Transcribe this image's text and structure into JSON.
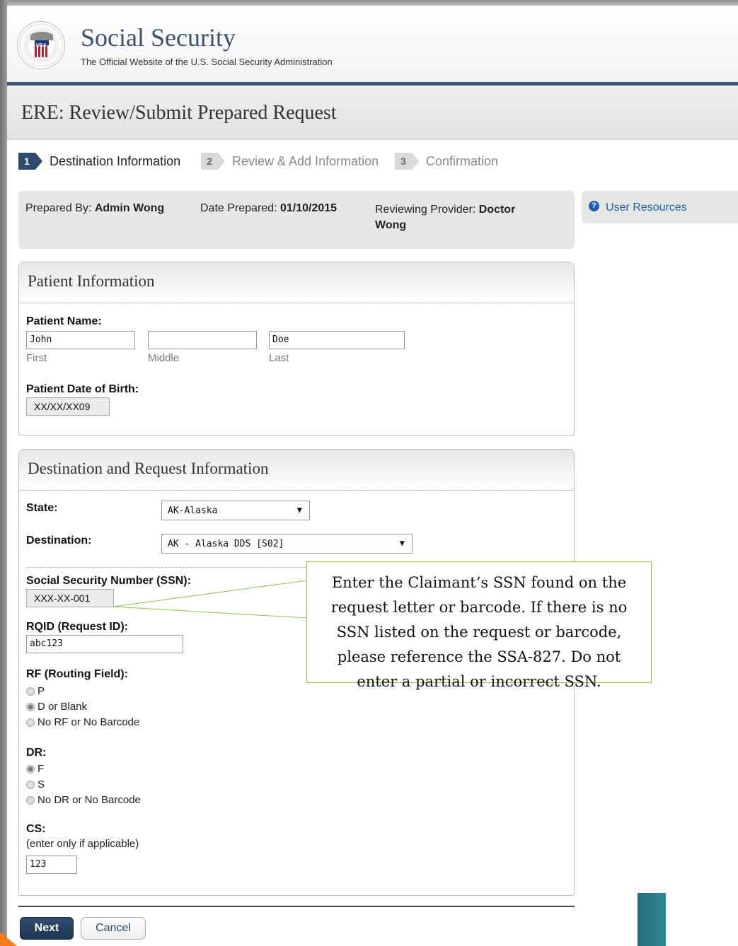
{
  "header": {
    "title": "Social Security",
    "subtitle": "The Official Website of the U.S. Social Security Administration",
    "seal_text": "USA"
  },
  "page_title": "ERE: Review/Submit Prepared Request",
  "steps": [
    {
      "num": "1",
      "label": "Destination Information",
      "active": true
    },
    {
      "num": "2",
      "label": "Review & Add Information",
      "active": false
    },
    {
      "num": "3",
      "label": "Confirmation",
      "active": false
    }
  ],
  "prepared": {
    "by_label": "Prepared By:",
    "by_value": "Admin Wong",
    "date_label": "Date Prepared:",
    "date_value": "01/10/2015",
    "provider_label": "Reviewing Provider:",
    "provider_value_1": "Doctor",
    "provider_value_2": "Wong"
  },
  "user_resources": {
    "label": "User Resources",
    "icon": "help-icon"
  },
  "patient": {
    "heading": "Patient Information",
    "name_label": "Patient Name:",
    "first_value": "John",
    "middle_value": "",
    "last_value": "Doe",
    "first_sub": "First",
    "middle_sub": "Middle",
    "last_sub": "Last",
    "dob_label": "Patient Date of Birth:",
    "dob_value": "XX/XX/XX09"
  },
  "destination": {
    "heading": "Destination and Request Information",
    "state_label": "State:",
    "state_value": "AK-Alaska",
    "dest_label": "Destination:",
    "dest_value": "AK - Alaska DDS [S02]",
    "ssn_label": "Social Security Number (SSN):",
    "ssn_value": "XXX-XX-001",
    "rqid_label": "RQID (Request ID):",
    "rqid_value": "abc123",
    "rf_label": "RF (Routing Field):",
    "rf_options": [
      {
        "label": "P",
        "selected": false
      },
      {
        "label": "D or Blank",
        "selected": true
      },
      {
        "label": "No RF or No Barcode",
        "selected": false
      }
    ],
    "dr_label": "DR:",
    "dr_options": [
      {
        "label": "F",
        "selected": true
      },
      {
        "label": "S",
        "selected": false
      },
      {
        "label": "No DR or No Barcode",
        "selected": false
      }
    ],
    "cs_label": "CS:",
    "cs_note": "(enter only if applicable)",
    "cs_value": "123"
  },
  "callout": {
    "lines": [
      "Enter the Claimant’s SSN found on the",
      "request letter or barcode.  If there is no",
      "SSN listed on the request or barcode,",
      "please reference the SSA-827.  Do not",
      "enter a partial or incorrect SSN."
    ]
  },
  "buttons": {
    "next": "Next",
    "cancel": "Cancel"
  },
  "colors": {
    "accent": "#2d4a6a",
    "link": "#1d5fa8",
    "callout_border": "#8cc04a"
  }
}
